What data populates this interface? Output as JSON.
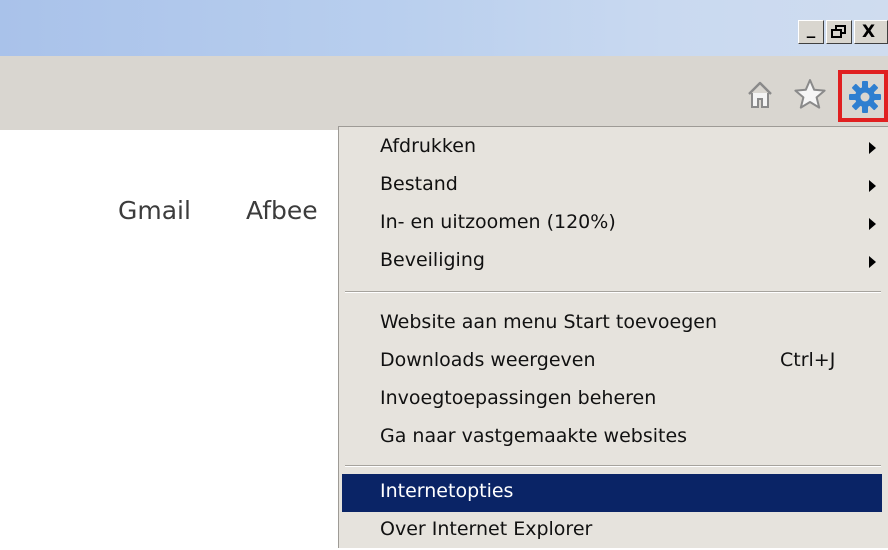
{
  "window": {
    "buttons": {
      "minimize": "_",
      "restore": "🗗",
      "close": "X"
    }
  },
  "toolbar": {
    "icons": [
      "home-icon",
      "star-icon",
      "gear-icon"
    ],
    "colors": {
      "highlight_border": "#e02020",
      "gear": "#2f7fd0"
    }
  },
  "page": {
    "links": {
      "gmail": "Gmail",
      "images": "Afbee"
    }
  },
  "menu": {
    "group1": [
      {
        "label": "Afdrukken",
        "submenu": true
      },
      {
        "label": "Bestand",
        "submenu": true
      },
      {
        "label": "In- en uitzoomen (120%)",
        "submenu": true
      },
      {
        "label": "Beveiliging",
        "submenu": true
      }
    ],
    "group2": [
      {
        "label": "Website aan menu Start toevoegen",
        "shortcut": ""
      },
      {
        "label": "Downloads weergeven",
        "shortcut": "Ctrl+J"
      },
      {
        "label": "Invoegtoepassingen beheren",
        "shortcut": ""
      },
      {
        "label": "Ga naar vastgemaakte websites",
        "shortcut": ""
      }
    ],
    "group3": [
      {
        "label": "Internetopties",
        "selected": true
      },
      {
        "label": "Over Internet Explorer",
        "selected": false
      }
    ],
    "colors": {
      "background": "#e6e3dd",
      "selected": "#0a2466"
    }
  }
}
